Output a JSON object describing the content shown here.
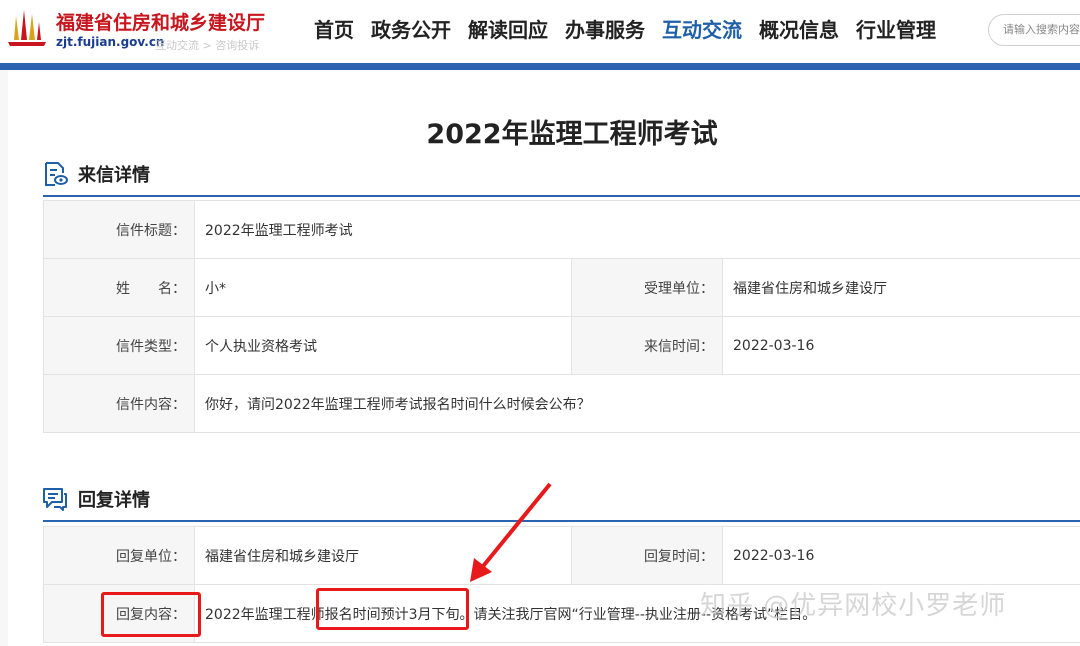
{
  "header": {
    "logo_title": "福建省住房和城乡建设厅",
    "logo_domain": "zjt.fujian.gov.cn",
    "breadcrumb": "互动交流 > 咨询投诉",
    "nav": [
      "首页",
      "政务公开",
      "解读回应",
      "办事服务",
      "互动交流",
      "概况信息",
      "行业管理"
    ],
    "active_nav": "互动交流",
    "search_placeholder": "请输入搜索内容"
  },
  "page_title": "2022年监理工程师考试",
  "letter": {
    "section_title": "来信详情",
    "subject_label": "信件标题：",
    "subject": "2022年监理工程师考试",
    "name_label": "姓　　名：",
    "name": "小*",
    "dept_label": "受理单位：",
    "dept": "福建省住房和城乡建设厅",
    "type_label": "信件类型：",
    "type": "个人执业资格考试",
    "time_label": "来信时间：",
    "time": "2022-03-16",
    "content_label": "信件内容：",
    "content": "你好，请问2022年监理工程师考试报名时间什么时候会公布？"
  },
  "reply": {
    "section_title": "回复详情",
    "dept_label": "回复单位：",
    "dept": "福建省住房和城乡建设厅",
    "time_label": "回复时间：",
    "time": "2022-03-16",
    "content_label": "回复内容：",
    "content": "2022年监理工程师报名时间预计3月下旬。请关注我厅官网“行业管理--执业注册--资格考试”栏目。"
  },
  "watermark": "知乎 @优异网校小罗老师",
  "colors": {
    "brand_red": "#c8161e",
    "nav_blue": "#1e5fa8",
    "bar_blue": "#2b63b0",
    "highlight_red": "#e8191a"
  }
}
